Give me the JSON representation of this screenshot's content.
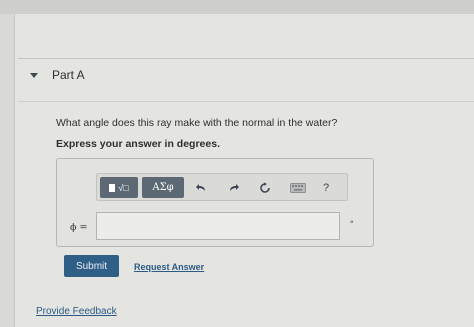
{
  "part": {
    "title": "Part A",
    "expanded": true
  },
  "question": {
    "text": "What angle does this ray make with the normal in the water?",
    "instruction": "Express your answer in degrees."
  },
  "toolbar": {
    "templates_label": "√□",
    "greek_label": "ΑΣφ",
    "help_label": "?",
    "icons": [
      "templates-icon",
      "undo-icon",
      "redo-icon",
      "reset-icon",
      "keyboard-icon",
      "help-icon"
    ]
  },
  "answer": {
    "variable_label": "ϕ =",
    "value": "",
    "unit": "°"
  },
  "actions": {
    "submit_label": "Submit",
    "request_answer_label": "Request Answer"
  },
  "footer": {
    "feedback_label": "Provide Feedback"
  },
  "colors": {
    "submit_bg": "#2f5f87",
    "link": "#2b5a86",
    "toolbar_button": "#5c6873"
  }
}
